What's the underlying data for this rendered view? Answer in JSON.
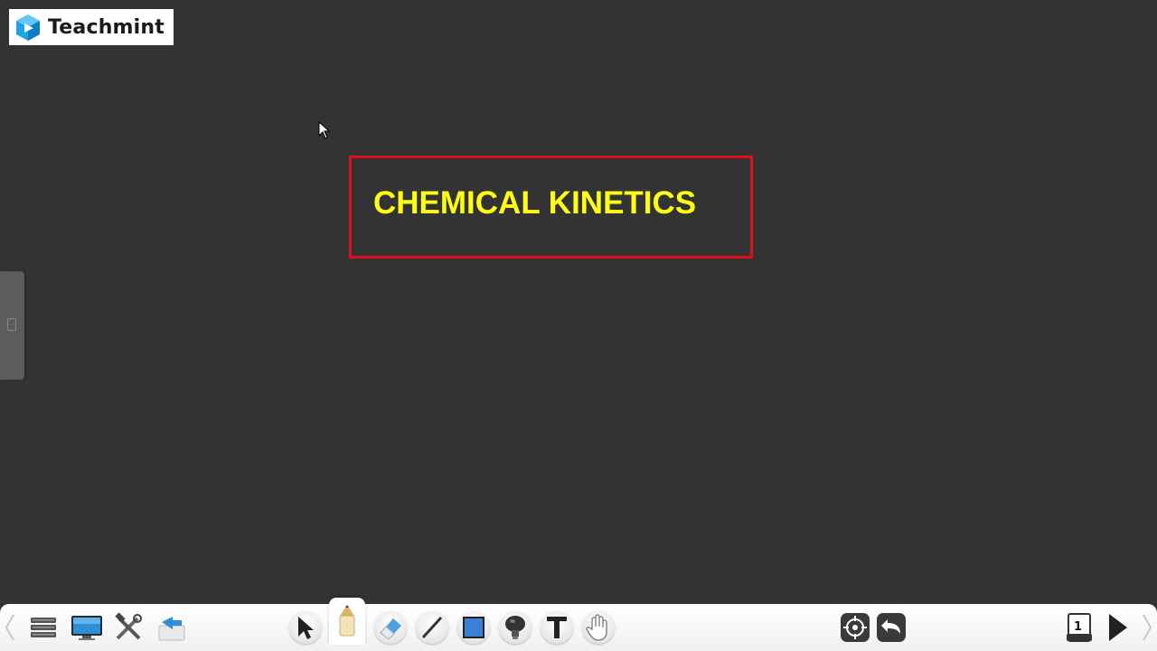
{
  "brand": {
    "name": "Teachmint"
  },
  "slide": {
    "title": "CHEMICAL KINETICS"
  },
  "colors": {
    "background": "#333333",
    "title_text": "#ffff14",
    "title_border": "#e0101a",
    "toolbar": "#f5f5f5"
  },
  "toolbar": {
    "left_tools": [
      "menu-icon",
      "screen-icon",
      "tools-icon",
      "open-file-icon"
    ],
    "drawing_tools": [
      "select-arrow-icon",
      "pen-icon",
      "eraser-icon",
      "line-icon",
      "rectangle-icon",
      "spotlight-icon",
      "text-icon",
      "hand-icon"
    ],
    "active_tool": "pen-icon",
    "right_tools": [
      "target-icon",
      "undo-icon"
    ],
    "page_number": "1"
  }
}
